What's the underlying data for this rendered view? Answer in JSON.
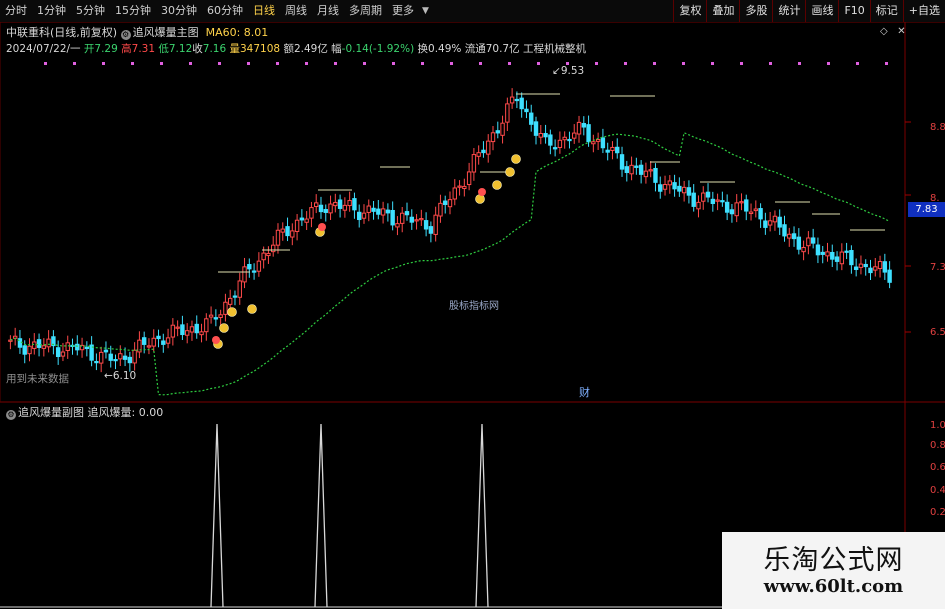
{
  "toolbar": {
    "periods": [
      "分时",
      "1分钟",
      "5分钟",
      "15分钟",
      "30分钟",
      "60分钟",
      "日线",
      "周线",
      "月线",
      "多周期",
      "更多"
    ],
    "active_period": "日线",
    "buttons": [
      "复权",
      "叠加",
      "多股",
      "统计",
      "画线",
      "F10",
      "标记",
      "+自选"
    ]
  },
  "stock": {
    "name": "中联重科(日线,前复权)",
    "indicator": "追风爆量主图",
    "ma_label": "MA60: 8.01",
    "date": "2024/07/22/一",
    "open_label": "开",
    "open": "7.29",
    "high_label": "高",
    "high": "7.31",
    "low_label": "低",
    "low": "7.12",
    "close_label": "收",
    "close": "7.16",
    "vol_label": "量",
    "volume": "347108",
    "amount_label": "额",
    "amount": "2.49亿",
    "change_label": "幅",
    "change": "-0.14(-1.92%)",
    "turnover": "换0.49%",
    "float_cap": "流通70.7亿",
    "sector": "工程机械整机"
  },
  "chart": {
    "current_price_tag": "7.83",
    "axis_labels": [
      "8.8",
      "8.",
      "7.3",
      "6.5"
    ],
    "sub_axis_labels": [
      "1.0",
      "0.8",
      "0.6",
      "0.4",
      "0.2"
    ],
    "high_marker": "9.53",
    "low_marker": "6.10",
    "future_note": "用到未来数据",
    "site_watermark": "股标指标网",
    "cai_marker": "财"
  },
  "sub_panel": {
    "name": "追风爆量副图",
    "value_label": "追风爆量: 0.00"
  },
  "watermark": {
    "cn": "乐淘公式网",
    "url": "www.60lt.com"
  },
  "colors": {
    "up": "#ff4a4a",
    "down": "#3ee0ff",
    "ma": "#2ecc40",
    "marker": "#e060e0",
    "coin": "#f0c030"
  }
}
